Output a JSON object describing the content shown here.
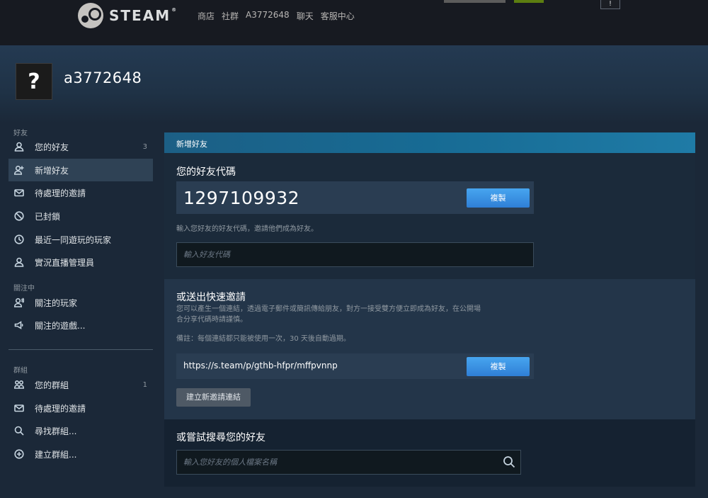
{
  "topbar": {
    "logo_text": "STEAM",
    "logo_sup": "®",
    "nav": [
      "商店",
      "社群",
      "A3772648",
      "聊天",
      "客服中心"
    ],
    "notif_label": "!"
  },
  "profile": {
    "avatar_glyph": "?",
    "name": "a3772648"
  },
  "sidebar": {
    "section_friends": "好友",
    "items_friends": [
      {
        "label": "您的好友",
        "count": "3",
        "icon": "person-icon"
      },
      {
        "label": "新增好友",
        "count": "",
        "icon": "add-person-icon"
      },
      {
        "label": "待處理的邀請",
        "count": "",
        "icon": "mail-icon"
      },
      {
        "label": "已封鎖",
        "count": "",
        "icon": "block-icon"
      },
      {
        "label": "最近一同遊玩的玩家",
        "count": "",
        "icon": "clock-icon"
      },
      {
        "label": "實況直播管理員",
        "count": "",
        "icon": "person-icon"
      }
    ],
    "section_following": "關注中",
    "items_following": [
      {
        "label": "關注的玩家",
        "count": "",
        "icon": "follow-person-icon"
      },
      {
        "label": "關注的遊戲...",
        "count": "",
        "icon": "megaphone-icon"
      }
    ],
    "section_groups": "群組",
    "items_groups": [
      {
        "label": "您的群組",
        "count": "1",
        "icon": "group-icon"
      },
      {
        "label": "待處理的邀請",
        "count": "",
        "icon": "mail-icon"
      },
      {
        "label": "尋找群組...",
        "count": "",
        "icon": "search-icon"
      },
      {
        "label": "建立群組...",
        "count": "",
        "icon": "plus-circle-icon"
      }
    ]
  },
  "panel": {
    "header": "新增好友",
    "friend_code_title": "您的好友代碼",
    "friend_code": "1297109932",
    "copy_label": "複製",
    "code_hint": "輸入您好友的好友代碼，邀請他們成為好友。",
    "code_input_placeholder": "輸入好友代碼",
    "quick_invite_title": "或送出快速邀請",
    "quick_invite_desc_1": "您可以產生一個連結，透過電子郵件或簡訊傳給朋友，對方一接受雙方便立即成為好友，在公開場",
    "quick_invite_desc_2": "合分享代碼時請謹慎。",
    "quick_invite_note": "備註：每個連結都只能被使用一次，30 天後自動過期。",
    "invite_link": "https://s.team/p/gthb-hfpr/mffpvnnp",
    "copy_link_label": "複製",
    "new_link_label": "建立新邀請連結",
    "search_title": "或嘗試搜尋您的好友",
    "search_placeholder": "輸入您好友的個人檔案名稱"
  }
}
